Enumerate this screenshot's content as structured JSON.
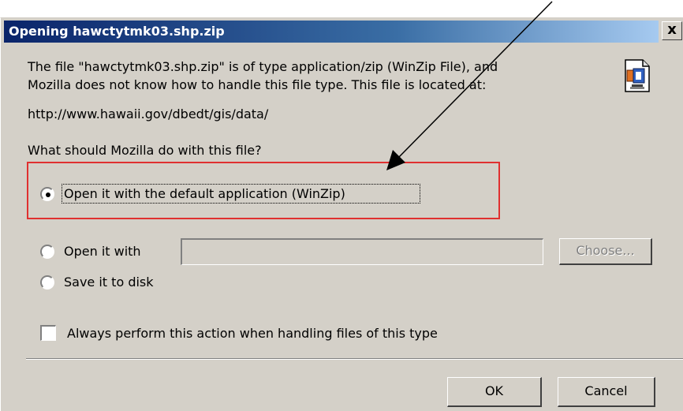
{
  "window": {
    "title": "Opening hawctytmk03.shp.zip",
    "close_label": "x"
  },
  "message": {
    "line1": "The file \"hawctytmk03.shp.zip\" is of type application/zip (WinZip File), and",
    "line2": "Mozilla does not know how to handle this file type. This file is located at:",
    "location": "http://www.hawaii.gov/dbedt/gis/data/",
    "question": "What should Mozilla do with this file?"
  },
  "icons": {
    "file_type": "zip-file-icon"
  },
  "options": {
    "open_default": {
      "label": "Open it with the default application (WinZip)",
      "checked": true
    },
    "open_with": {
      "label": "Open it with",
      "path_value": "",
      "choose_label": "Choose...",
      "choose_enabled": false
    },
    "save": {
      "label": "Save it to disk",
      "checked": false
    },
    "always": {
      "label": "Always perform this action when handling files of this type",
      "checked": false
    }
  },
  "buttons": {
    "ok": "OK",
    "cancel": "Cancel"
  },
  "annotation": {
    "highlight_color": "#e03030",
    "arrow_color": "#000000"
  }
}
